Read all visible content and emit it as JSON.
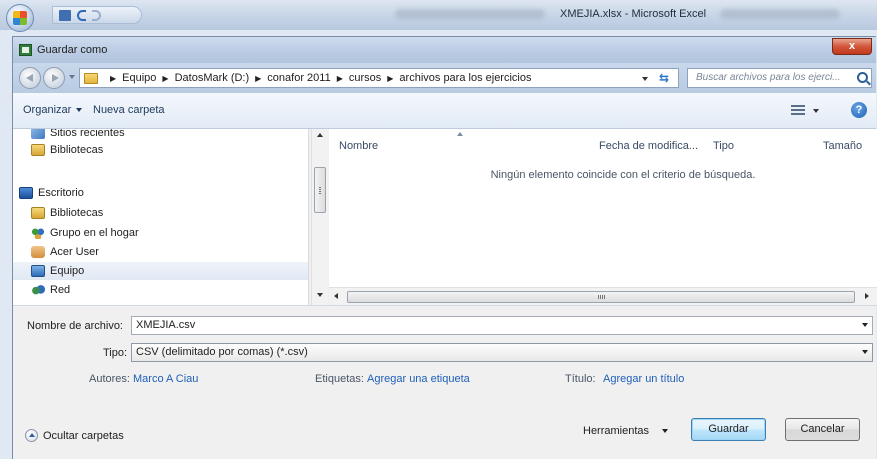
{
  "excel": {
    "title": "XMEJIA.xlsx - Microsoft Excel"
  },
  "dialog": {
    "title": "Guardar como",
    "close_label": "x"
  },
  "address": {
    "crumbs": [
      "Equipo",
      "DatosMark (D:)",
      "conafor 2011",
      "cursos",
      "archivos para los ejercicios"
    ],
    "search_placeholder": "Buscar archivos para los ejerci..."
  },
  "toolbar": {
    "organize_label": "Organizar",
    "new_folder_label": "Nueva carpeta",
    "help_label": "?"
  },
  "nav": {
    "items": [
      {
        "label": "Sitios recientes",
        "icon": "recent-places-icon"
      },
      {
        "label": "Bibliotecas",
        "icon": "libraries-icon"
      },
      {
        "label": "Escritorio",
        "icon": "desktop-icon"
      },
      {
        "label": "Bibliotecas",
        "icon": "libraries-icon"
      },
      {
        "label": "Grupo en el hogar",
        "icon": "homegroup-icon"
      },
      {
        "label": "Acer User",
        "icon": "user-folder-icon"
      },
      {
        "label": "Equipo",
        "icon": "computer-icon",
        "selected": true
      },
      {
        "label": "Red",
        "icon": "network-icon"
      }
    ]
  },
  "file_list": {
    "columns": [
      "Nombre",
      "Fecha de modifica...",
      "Tipo",
      "Tamaño"
    ],
    "empty_message": "Ningún elemento coincide con el criterio de búsqueda."
  },
  "form": {
    "filename_label": "Nombre de archivo:",
    "filename_value": "XMEJIA.csv",
    "type_label": "Tipo:",
    "type_value": "CSV (delimitado por comas) (*.csv)",
    "authors_label": "Autores:",
    "authors_value": "Marco A Ciau",
    "tags_label": "Etiquetas:",
    "tags_value": "Agregar una etiqueta",
    "title_label": "Título:",
    "title_value": "Agregar un título"
  },
  "footer": {
    "hide_folders_label": "Ocultar carpetas",
    "tools_label": "Herramientas",
    "save_label": "Guardar",
    "cancel_label": "Cancelar"
  },
  "colors": {
    "link": "#2060b8",
    "title_bar": "#bccde4"
  }
}
